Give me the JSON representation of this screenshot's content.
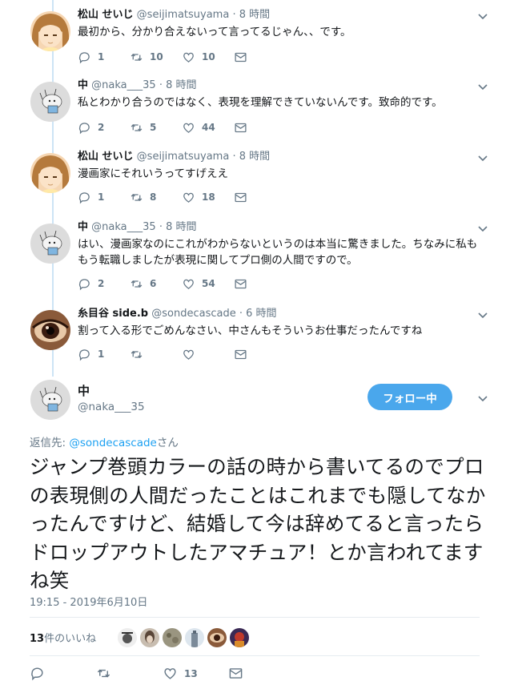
{
  "thread": [
    {
      "name": "松山 せいじ",
      "handle": "@seijimatsuyama",
      "time": "8 時間",
      "text": "最初から、分かり合えないって言ってるじゃん、、です。",
      "replies": "1",
      "retweets": "10",
      "likes": "10",
      "avatar": "anime-girl-avatar"
    },
    {
      "name": "中",
      "handle": "@naka___35",
      "time": "8 時間",
      "text": "私とわかり合うのではなく、表現を理解できていないんです。致命的です。",
      "replies": "2",
      "retweets": "5",
      "likes": "44",
      "avatar": "sketch-avatar"
    },
    {
      "name": "松山 せいじ",
      "handle": "@seijimatsuyama",
      "time": "8 時間",
      "text": "漫画家にそれいうってすげええ",
      "replies": "1",
      "retweets": "8",
      "likes": "18",
      "avatar": "anime-girl-avatar"
    },
    {
      "name": "中",
      "handle": "@naka___35",
      "time": "8 時間",
      "text": "はい、漫画家なのにこれがわからないというのは本当に驚きました。ちなみに私ももう転職しましたが表現に関してプロ側の人間ですので。",
      "replies": "2",
      "retweets": "6",
      "likes": "54",
      "avatar": "sketch-avatar"
    },
    {
      "name": "糸目谷 side.b",
      "handle": "@sondecascade",
      "time": "6 時間",
      "text": "割って入る形でごめんなさい、中さんもそういうお仕事だったんですね",
      "replies": "1",
      "retweets": "",
      "likes": "",
      "avatar": "eye-closeup-avatar"
    }
  ],
  "main": {
    "name": "中",
    "handle": "@naka___35",
    "follow_label": "フォロー中",
    "reply_prefix": "返信先: ",
    "reply_link": "@sondecascade",
    "reply_suffix": "さん",
    "text": "ジャンプ巻頭カラーの話の時から書いてるのでプロの表現側の人間だったことはこれまでも隠してなかったんですけど、結婚して今は辞めてると言ったらドロップアウトしたアマチュア！とか言われてますね笑",
    "timestamp": "19:15 - 2019年6月10日",
    "like_count": "13",
    "like_label": "件のいいね",
    "likes": "13",
    "replies": "",
    "retweets": ""
  },
  "colors": {
    "accent": "#1da1f2",
    "follow_bg": "#4aa7ec",
    "thread_line": "#cde4f5",
    "muted": "#657786"
  }
}
